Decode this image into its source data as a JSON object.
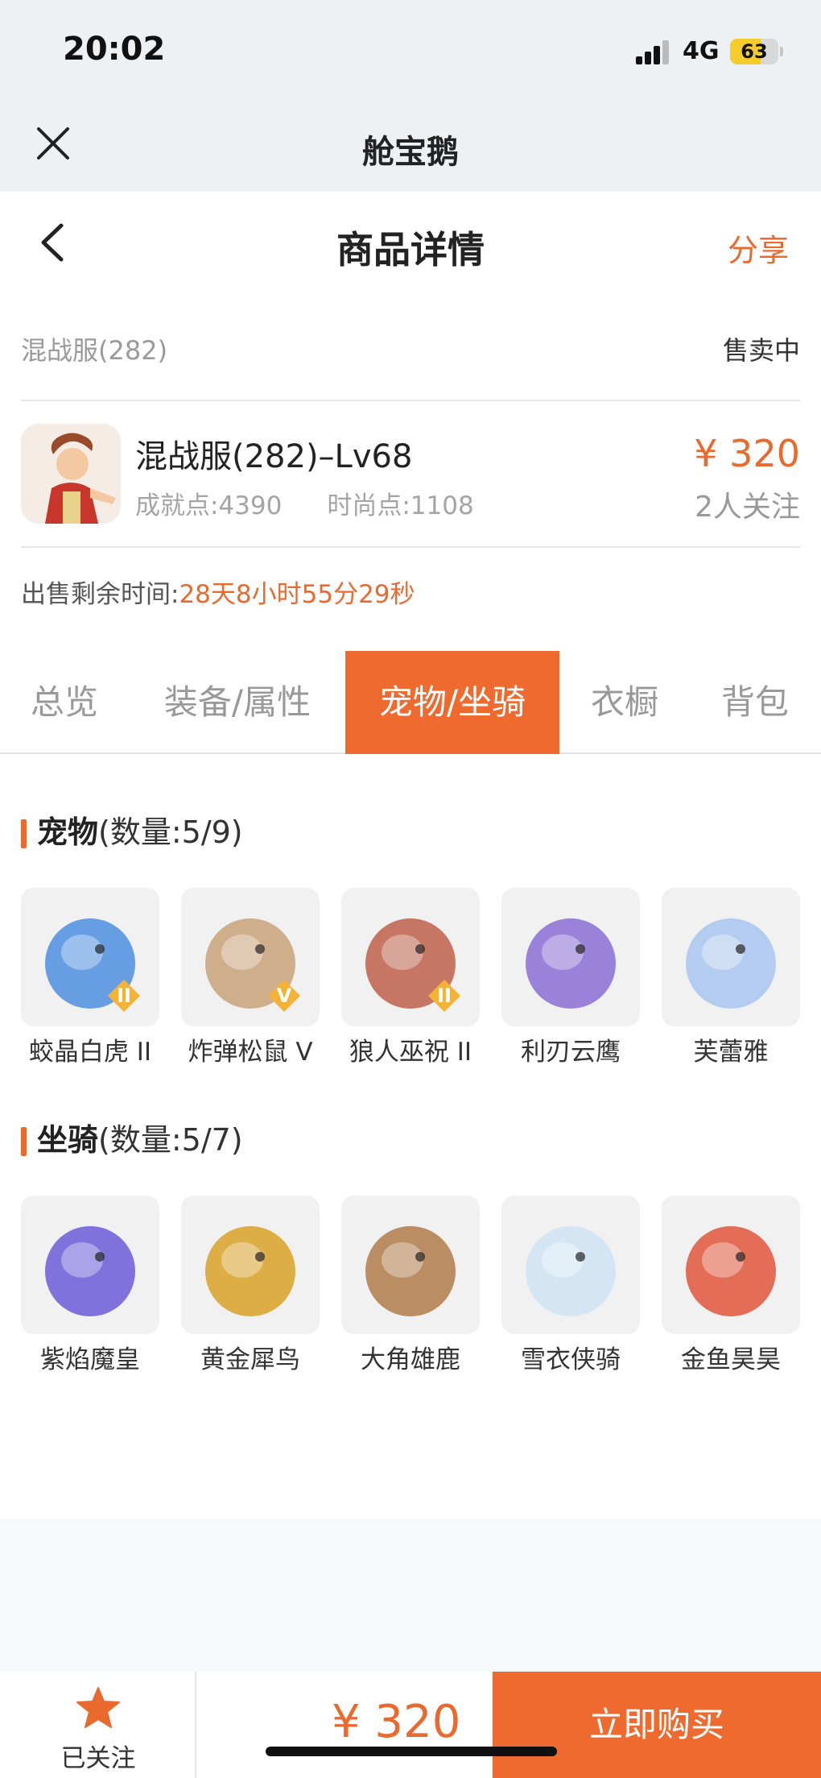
{
  "status_bar": {
    "time": "20:02",
    "network": "4G",
    "battery": "63",
    "battery_level": 0.63
  },
  "app": {
    "title": "舱宝鹅"
  },
  "nav": {
    "title": "商品详情",
    "share": "分享"
  },
  "listing": {
    "server": "混战服(282)",
    "status": "售卖中",
    "title": "混战服(282)–Lv68",
    "achievement": "成就点:4390",
    "fashion": "时尚点:1108",
    "price": "¥ 320",
    "followers": "2人关注",
    "remaining_label": "出售剩余时间:",
    "remaining_time": "28天8小时55分29秒"
  },
  "tabs": [
    {
      "label": "总览",
      "active": false
    },
    {
      "label": "装备/属性",
      "active": false
    },
    {
      "label": "宠物/坐骑",
      "active": true
    },
    {
      "label": "衣橱",
      "active": false
    },
    {
      "label": "背包",
      "active": false
    }
  ],
  "pets": {
    "title": "宠物",
    "count": "(数量:5/9)",
    "items": [
      {
        "name": "蛟晶白虎 II",
        "badge": "II",
        "color": "#4f8fe0"
      },
      {
        "name": "炸弹松鼠 V",
        "badge": "V",
        "color": "#c9a27a"
      },
      {
        "name": "狼人巫祝 II",
        "badge": "II",
        "color": "#c0604a"
      },
      {
        "name": "利刃云鹰",
        "badge": "",
        "color": "#8b6fd6"
      },
      {
        "name": "芙蕾雅",
        "badge": "",
        "color": "#a9c6ef"
      }
    ]
  },
  "mounts": {
    "title": "坐骑",
    "count": "(数量:5/7)",
    "items": [
      {
        "name": "紫焰魔皇",
        "color": "#6c5bd8"
      },
      {
        "name": "黄金犀鸟",
        "color": "#d9a227"
      },
      {
        "name": "大角雄鹿",
        "color": "#b07b4a"
      },
      {
        "name": "雪衣侠骑",
        "color": "#cfe4f3"
      },
      {
        "name": "金鱼昊昊",
        "color": "#e0563b"
      }
    ]
  },
  "footer": {
    "follow_label": "已关注",
    "price": "¥ 320",
    "buy_label": "立即购买"
  },
  "colors": {
    "accent": "#ee6a2e",
    "header_bg": "#eef1f4"
  }
}
